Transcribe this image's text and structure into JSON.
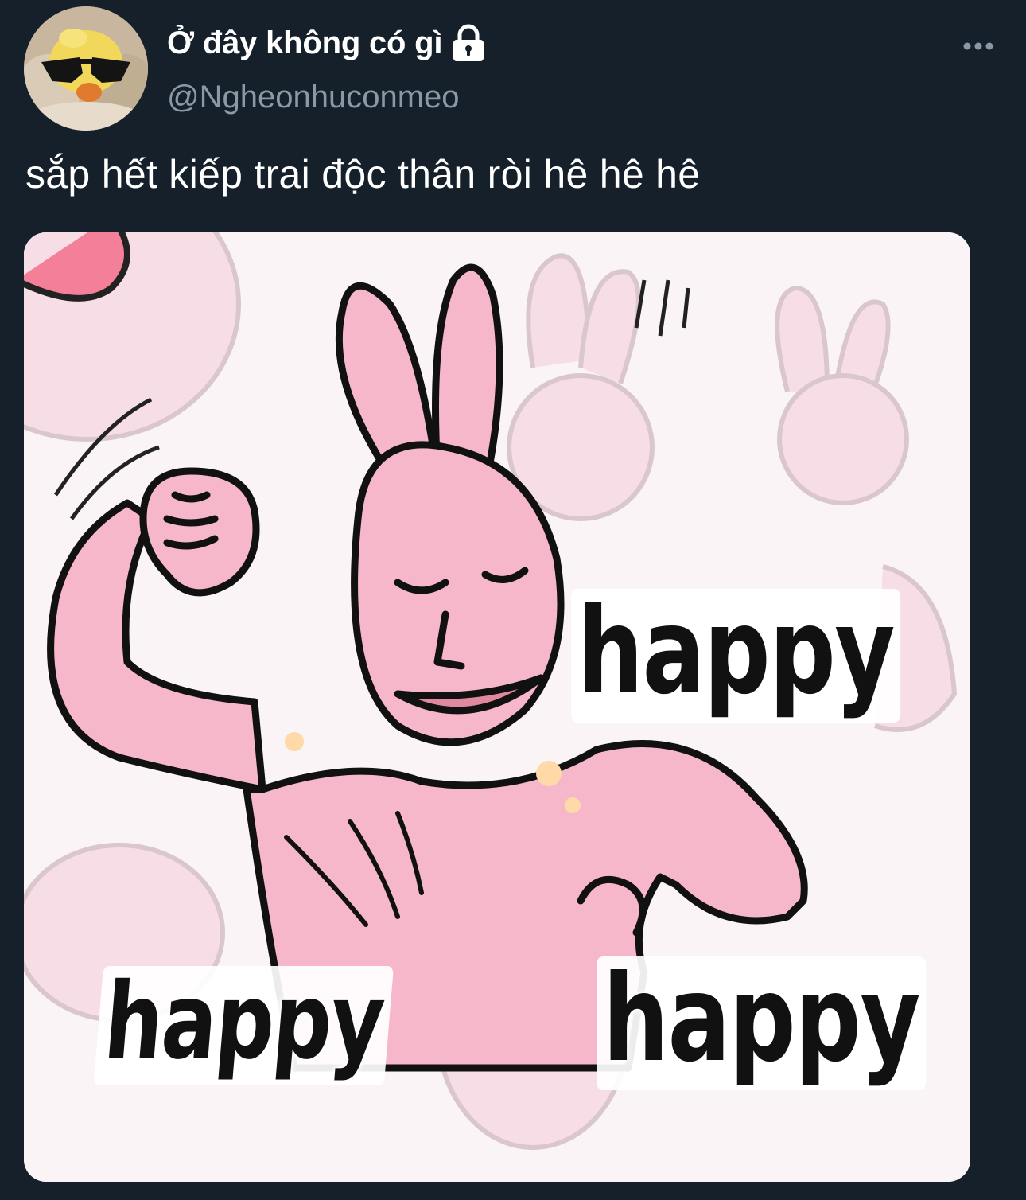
{
  "author": {
    "display_name": "Ở đây không có gì",
    "username": "@Ngheonhuconmeo",
    "protected": true,
    "avatar_icon": "duck-with-sunglasses-avatar"
  },
  "tweet": {
    "text": "sắp hết kiếp trai độc thân ròi hê hê hê"
  },
  "media": {
    "icon": "pink-bunny-meme-image",
    "captions": [
      "happy",
      "happy",
      "happy"
    ]
  },
  "icons": {
    "lock": "lock-icon",
    "more": "more-horizontal-icon"
  },
  "colors": {
    "background": "#15202b",
    "text_primary": "#ffffff",
    "text_secondary": "#8b98a5",
    "bunny_pink": "#f6b7cb"
  }
}
